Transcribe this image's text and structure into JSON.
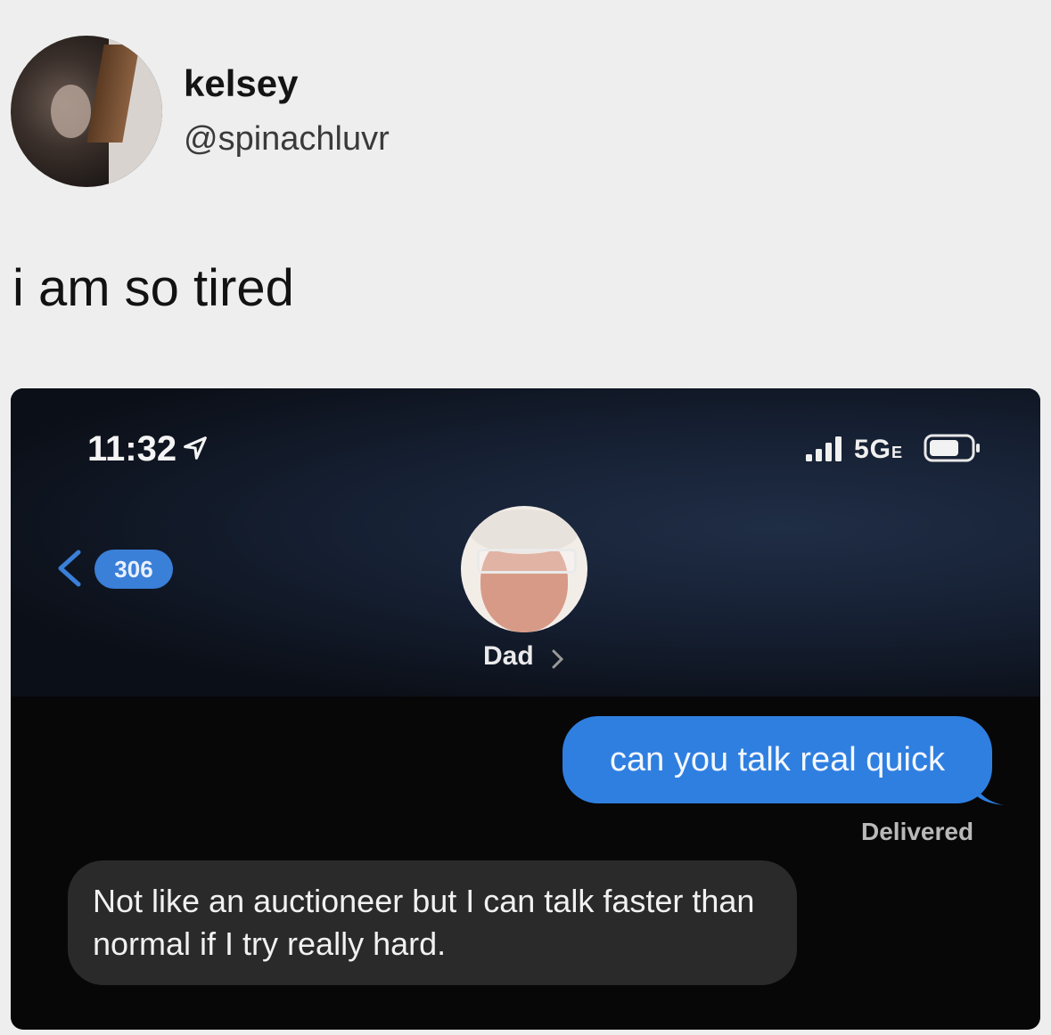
{
  "tweet": {
    "display_name": "kelsey",
    "handle": "@spinachluvr",
    "text": "i am so tired"
  },
  "phone": {
    "status_bar": {
      "time": "11:32",
      "network": "5G",
      "network_suffix": "E",
      "icons": [
        "location-arrow-icon",
        "signal-icon",
        "battery-icon"
      ]
    },
    "header": {
      "back_badge": "306",
      "contact_name": "Dad"
    },
    "messages": [
      {
        "direction": "outgoing",
        "text": "can you talk real quick",
        "status": "Delivered"
      },
      {
        "direction": "incoming",
        "text": "Not like an auctioneer but I can talk faster than normal if I try really hard."
      }
    ],
    "colors": {
      "outgoing_bubble": "#2f7fe0",
      "incoming_bubble": "#2a2a2b",
      "badge": "#3a7fd8"
    }
  }
}
